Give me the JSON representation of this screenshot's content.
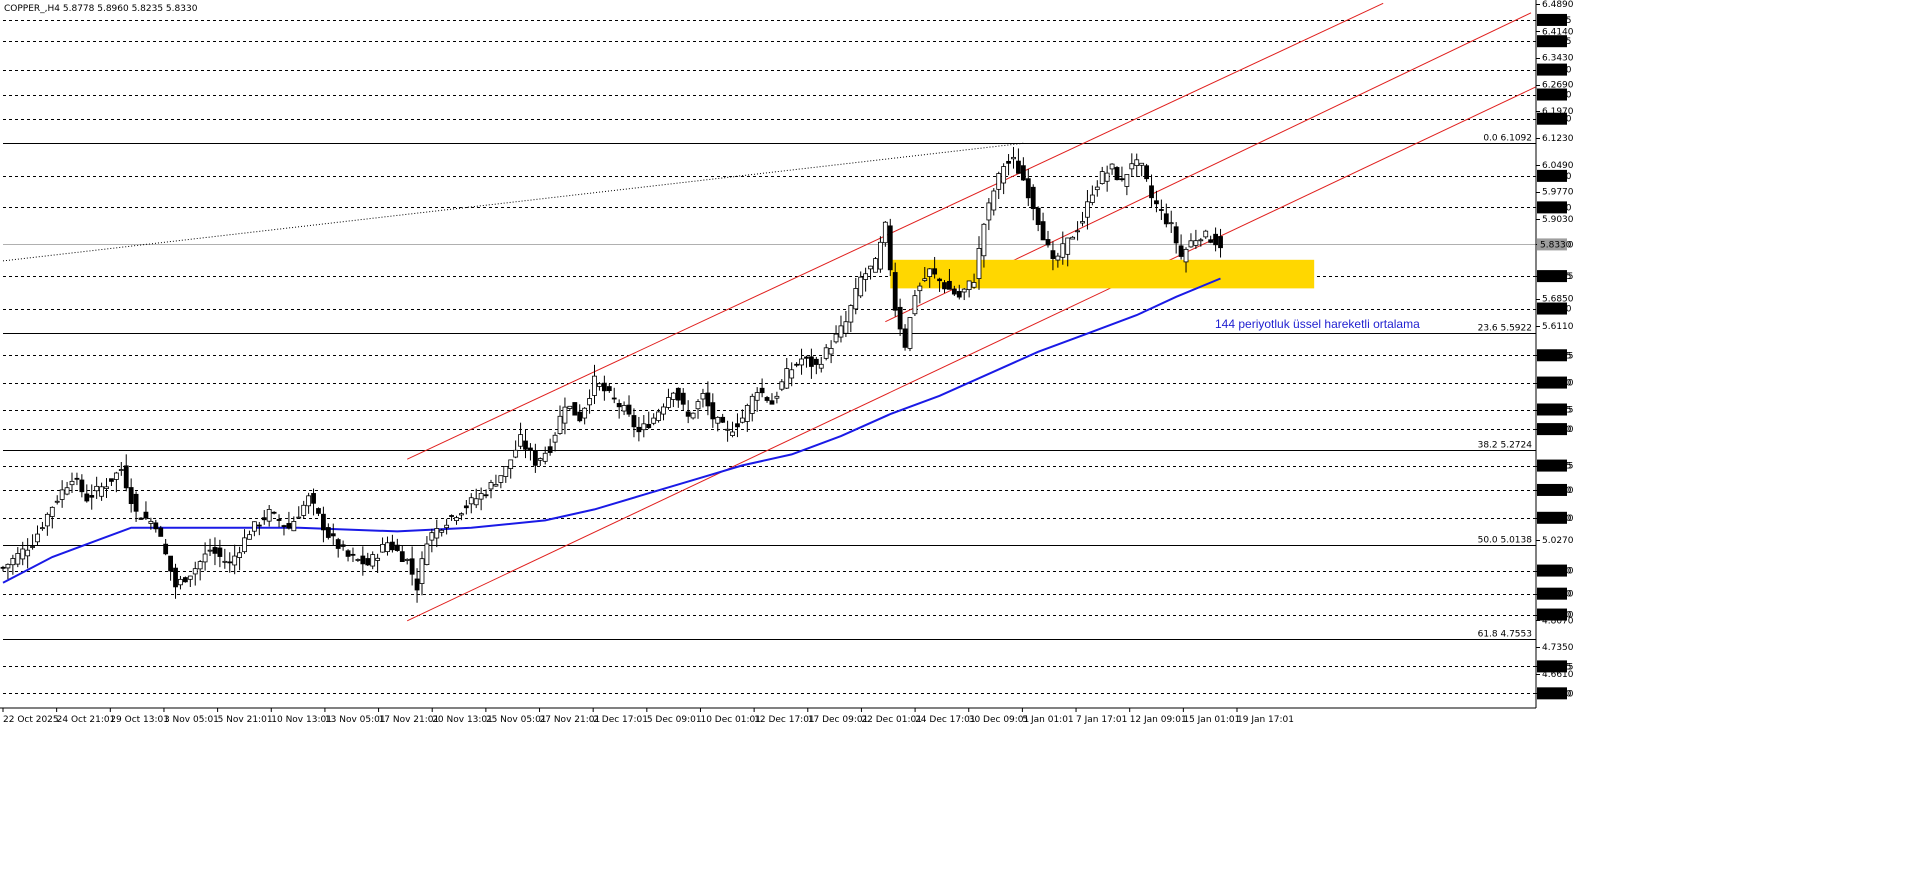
{
  "header": {
    "symbol_line": "COPPER_,H4  5.8778 5.8960 5.8235 5.8330"
  },
  "annotation": "144 periyotluk üssel hareketli ortalama",
  "colors": {
    "background": "#ffffff",
    "grid": "#000000",
    "channel": "#e0201e",
    "ema": "#1a1ae6",
    "zone": "#ffd700",
    "candle": "#000000",
    "price_box": "#000000"
  },
  "chart_data": {
    "type": "candlestick",
    "symbol": "COPPER_",
    "timeframe": "H4",
    "ohlc_current": {
      "open": 5.8778,
      "high": 5.896,
      "low": 5.8235,
      "close": 5.833
    },
    "ylim": [
      4.568,
      6.489
    ],
    "xlim_index": [
      0,
      300
    ],
    "y_tick_labels": [
      6.489,
      6.414,
      6.343,
      6.269,
      6.197,
      6.123,
      6.049,
      5.977,
      5.903,
      5.833,
      5.7465,
      5.685,
      5.611,
      5.5305,
      5.456,
      5.3825,
      5.329,
      5.2295,
      5.163,
      5.087,
      5.027,
      4.943,
      4.88,
      4.823,
      4.807,
      4.735,
      4.661,
      4.6815,
      4.608
    ],
    "boxed_levels": [
      6.4455,
      6.3875,
      6.31,
      6.242,
      6.176,
      6.02,
      5.934,
      5.833,
      5.7465,
      5.658,
      5.5305,
      5.456,
      5.3825,
      5.329,
      5.2295,
      5.163,
      5.087,
      4.943,
      4.88,
      4.823,
      4.6815,
      4.608
    ],
    "dashed_levels": [
      6.4455,
      6.3875,
      6.31,
      6.242,
      6.176,
      6.02,
      5.934,
      5.7465,
      5.658,
      5.5305,
      5.456,
      5.3825,
      5.329,
      5.2295,
      5.163,
      5.087,
      4.943,
      4.88,
      4.823,
      4.6815,
      4.608
    ],
    "current_price_level": 5.833,
    "fibonacci": [
      {
        "label": "0.0 6.1092",
        "value": 6.1092
      },
      {
        "label": "23.6 5.5922",
        "value": 5.5922
      },
      {
        "label": "38.2 5.2724",
        "value": 5.2724
      },
      {
        "label": "50.0 5.0138",
        "value": 5.0138
      },
      {
        "label": "61.8 4.7553",
        "value": 4.7553
      }
    ],
    "x_tick_labels": [
      "22 Oct 2025",
      "24 Oct 21:01",
      "29 Oct 13:01",
      "3 Nov 05:01",
      "5 Nov 21:01",
      "10 Nov 13:01",
      "13 Nov 05:01",
      "17 Nov 21:01",
      "20 Nov 13:01",
      "25 Nov 05:01",
      "27 Nov 21:01",
      "2 Dec 17:01",
      "5 Dec 09:01",
      "10 Dec 01:01",
      "12 Dec 17:01",
      "17 Dec 09:01",
      "22 Dec 01:01",
      "24 Dec 17:01",
      "30 Dec 09:01",
      "5 Jan 01:01",
      "7 Jan 17:01",
      "12 Jan 09:01",
      "15 Jan 01:01",
      "19 Jan 17:01"
    ],
    "close_path": [
      [
        0,
        4.95
      ],
      [
        6,
        5.02
      ],
      [
        10,
        5.12
      ],
      [
        14,
        5.2
      ],
      [
        17,
        5.14
      ],
      [
        21,
        5.18
      ],
      [
        24,
        5.22
      ],
      [
        27,
        5.1
      ],
      [
        31,
        5.07
      ],
      [
        35,
        4.9
      ],
      [
        39,
        4.95
      ],
      [
        42,
        5.0
      ],
      [
        46,
        4.96
      ],
      [
        50,
        5.05
      ],
      [
        54,
        5.1
      ],
      [
        58,
        5.06
      ],
      [
        62,
        5.14
      ],
      [
        66,
        5.04
      ],
      [
        70,
        4.98
      ],
      [
        74,
        4.96
      ],
      [
        78,
        5.02
      ],
      [
        82,
        4.97
      ],
      [
        84,
        4.9
      ],
      [
        86,
        5.03
      ],
      [
        90,
        5.08
      ],
      [
        94,
        5.12
      ],
      [
        98,
        5.16
      ],
      [
        102,
        5.22
      ],
      [
        105,
        5.3
      ],
      [
        108,
        5.24
      ],
      [
        111,
        5.28
      ],
      [
        114,
        5.4
      ],
      [
        117,
        5.36
      ],
      [
        120,
        5.46
      ],
      [
        123,
        5.42
      ],
      [
        126,
        5.38
      ],
      [
        129,
        5.32
      ],
      [
        132,
        5.36
      ],
      [
        136,
        5.44
      ],
      [
        139,
        5.36
      ],
      [
        142,
        5.42
      ],
      [
        144,
        5.36
      ],
      [
        147,
        5.32
      ],
      [
        150,
        5.36
      ],
      [
        153,
        5.44
      ],
      [
        156,
        5.4
      ],
      [
        159,
        5.48
      ],
      [
        162,
        5.52
      ],
      [
        165,
        5.5
      ],
      [
        168,
        5.56
      ],
      [
        171,
        5.62
      ],
      [
        174,
        5.74
      ],
      [
        177,
        5.78
      ],
      [
        179,
        5.88
      ],
      [
        181,
        5.66
      ],
      [
        183,
        5.56
      ],
      [
        185,
        5.7
      ],
      [
        188,
        5.76
      ],
      [
        191,
        5.72
      ],
      [
        194,
        5.69
      ],
      [
        197,
        5.74
      ],
      [
        199,
        5.89
      ],
      [
        201,
        5.98
      ],
      [
        203,
        6.05
      ],
      [
        205,
        6.06
      ],
      [
        207,
        6.01
      ],
      [
        209,
        5.94
      ],
      [
        211,
        5.86
      ],
      [
        213,
        5.78
      ],
      [
        215,
        5.82
      ],
      [
        217,
        5.86
      ],
      [
        219,
        5.9
      ],
      [
        221,
        5.98
      ],
      [
        223,
        6.02
      ],
      [
        225,
        6.04
      ],
      [
        227,
        6.0
      ],
      [
        229,
        6.06
      ],
      [
        231,
        6.04
      ],
      [
        233,
        5.96
      ],
      [
        235,
        5.92
      ],
      [
        237,
        5.88
      ],
      [
        239,
        5.8
      ],
      [
        241,
        5.84
      ],
      [
        243,
        5.86
      ],
      [
        245,
        5.85
      ],
      [
        247,
        5.833
      ]
    ],
    "ema144": [
      [
        0,
        4.91
      ],
      [
        10,
        4.98
      ],
      [
        20,
        5.03
      ],
      [
        26,
        5.06
      ],
      [
        40,
        5.06
      ],
      [
        60,
        5.06
      ],
      [
        80,
        5.05
      ],
      [
        95,
        5.06
      ],
      [
        110,
        5.08
      ],
      [
        120,
        5.11
      ],
      [
        130,
        5.15
      ],
      [
        140,
        5.19
      ],
      [
        150,
        5.23
      ],
      [
        160,
        5.26
      ],
      [
        170,
        5.31
      ],
      [
        180,
        5.37
      ],
      [
        190,
        5.42
      ],
      [
        200,
        5.48
      ],
      [
        210,
        5.54
      ],
      [
        220,
        5.59
      ],
      [
        230,
        5.64
      ],
      [
        238,
        5.69
      ],
      [
        247,
        5.74
      ]
    ],
    "channel_lines": [
      {
        "name": "upper",
        "x1": 82,
        "y1": 5.247,
        "x2": 280,
        "y2": 6.491
      },
      {
        "name": "middle",
        "x1": 179,
        "y1": 5.622,
        "x2": 310,
        "y2": 6.465
      },
      {
        "name": "lower",
        "x1": 82,
        "y1": 4.806,
        "x2": 311,
        "y2": 6.263
      }
    ],
    "dotted_trend": {
      "x1": 0,
      "y1": 5.788,
      "x2": 207,
      "y2": 6.109
    },
    "yellow_zone": {
      "x_start": 180,
      "x_end": 266,
      "y_low": 5.713,
      "y_high": 5.791
    },
    "gridlines": true,
    "legend": "none"
  }
}
